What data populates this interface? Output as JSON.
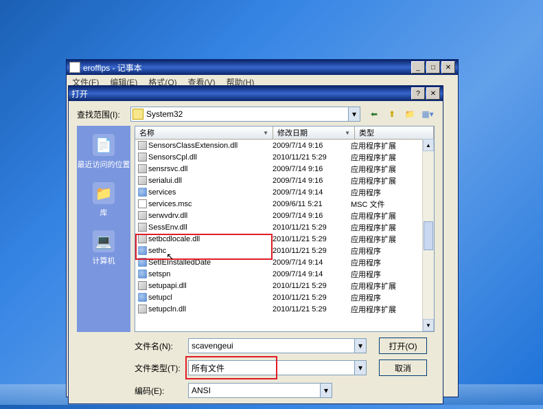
{
  "notepad": {
    "title": "erofflps - 记事本",
    "menus": [
      "文件(F)",
      "编辑(E)",
      "格式(O)",
      "查看(V)",
      "帮助(H)"
    ]
  },
  "dialog": {
    "title": "打开",
    "lookin_label": "查找范围(I):",
    "lookin_value": "System32",
    "sidebar": [
      {
        "icon": "📄",
        "label": "最近访问的位置"
      },
      {
        "icon": "📁",
        "label": "库"
      },
      {
        "icon": "💻",
        "label": "计算机"
      }
    ],
    "columns": {
      "name": "名称",
      "date": "修改日期",
      "type": "类型"
    },
    "files": [
      {
        "i": "dll",
        "n": "SensorsClassExtension.dll",
        "d": "2009/7/14 9:16",
        "t": "应用程序扩展"
      },
      {
        "i": "dll",
        "n": "SensorsCpl.dll",
        "d": "2010/11/21 5:29",
        "t": "应用程序扩展"
      },
      {
        "i": "dll",
        "n": "sensrsvc.dll",
        "d": "2009/7/14 9:16",
        "t": "应用程序扩展"
      },
      {
        "i": "dll",
        "n": "serialui.dll",
        "d": "2009/7/14 9:16",
        "t": "应用程序扩展"
      },
      {
        "i": "exe",
        "n": "services",
        "d": "2009/7/14 9:14",
        "t": "应用程序"
      },
      {
        "i": "msc",
        "n": "services.msc",
        "d": "2009/6/11 5:21",
        "t": "MSC 文件"
      },
      {
        "i": "dll",
        "n": "serwvdrv.dll",
        "d": "2009/7/14 9:16",
        "t": "应用程序扩展"
      },
      {
        "i": "dll",
        "n": "SessEnv.dll",
        "d": "2010/11/21 5:29",
        "t": "应用程序扩展"
      },
      {
        "i": "dll",
        "n": "setbcdlocale.dll",
        "d": "2010/11/21 5:29",
        "t": "应用程序扩展"
      },
      {
        "i": "exe",
        "n": "sethc",
        "d": "2010/11/21 5:29",
        "t": "应用程序"
      },
      {
        "i": "exe",
        "n": "SetIEInstalledDate",
        "d": "2009/7/14 9:14",
        "t": "应用程序"
      },
      {
        "i": "exe",
        "n": "setspn",
        "d": "2009/7/14 9:14",
        "t": "应用程序"
      },
      {
        "i": "dll",
        "n": "setupapi.dll",
        "d": "2010/11/21 5:29",
        "t": "应用程序扩展"
      },
      {
        "i": "exe",
        "n": "setupcl",
        "d": "2010/11/21 5:29",
        "t": "应用程序"
      },
      {
        "i": "dll",
        "n": "setupcln.dll",
        "d": "2010/11/21 5:29",
        "t": "应用程序扩展"
      }
    ],
    "filename_label": "文件名(N):",
    "filename_value": "scavengeui",
    "filetype_label": "文件类型(T):",
    "filetype_value": "所有文件",
    "encoding_label": "编码(E):",
    "encoding_value": "ANSI",
    "open_btn": "打开(O)",
    "cancel_btn": "取消"
  }
}
